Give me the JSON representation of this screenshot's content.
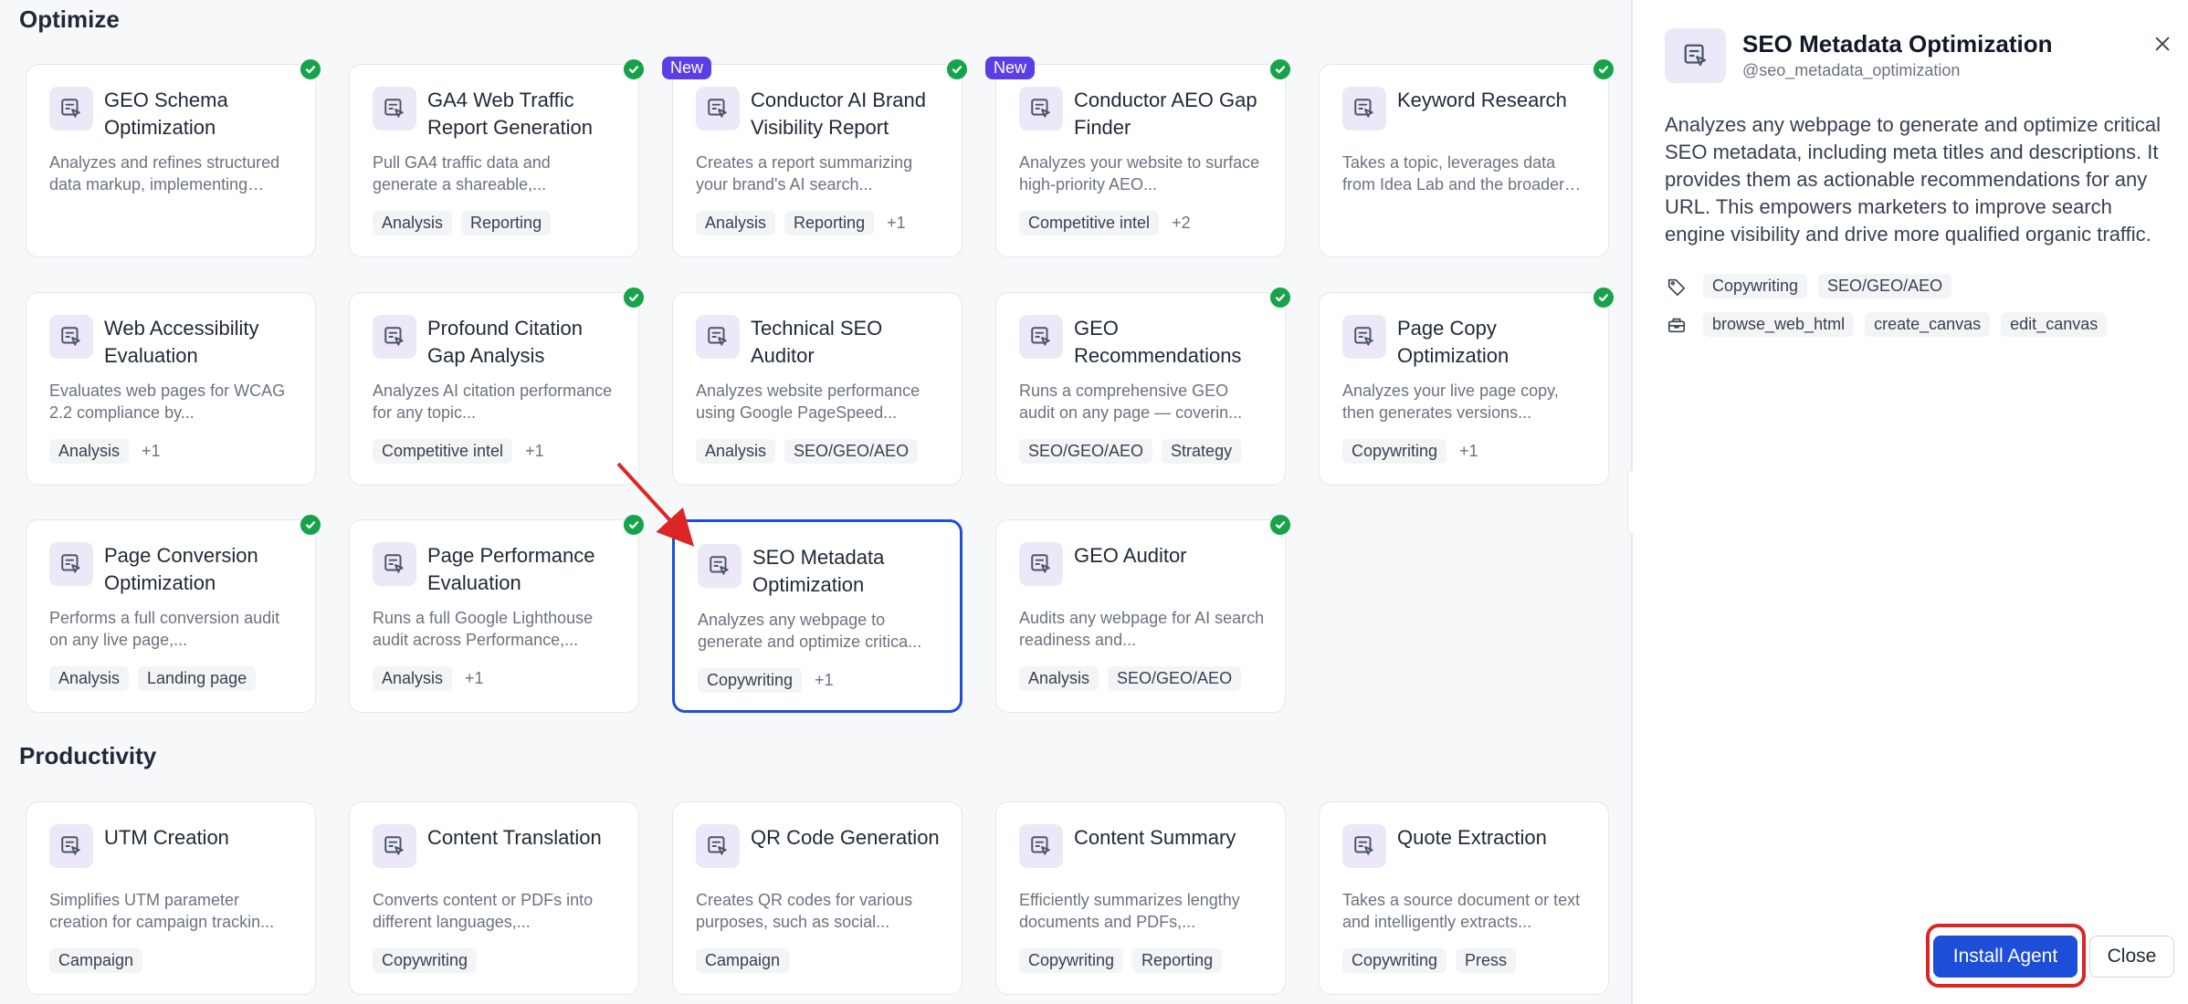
{
  "colors": {
    "accent": "#1d4ed8",
    "check": "#16a34a",
    "new_badge": "#5b3ee6",
    "highlight": "#dc2626"
  },
  "sections": {
    "optimize": "Optimize",
    "productivity": "Productivity"
  },
  "optimize_cards": [
    {
      "title": "GEO Schema Optimization",
      "desc": "Analyzes and refines structured data markup, implementing schema...",
      "tags": [],
      "more": "",
      "installed": true,
      "new": false,
      "icon": "agent-icon"
    },
    {
      "title": "GA4 Web Traffic Report Generation",
      "desc": "Pull GA4 traffic data and generate a shareable,...",
      "tags": [
        "Analysis",
        "Reporting"
      ],
      "more": "",
      "installed": true,
      "new": false,
      "icon": "agent-icon"
    },
    {
      "title": "Conductor AI Brand Visibility Report",
      "desc": "Creates a report summarizing your brand's AI search...",
      "tags": [
        "Analysis",
        "Reporting"
      ],
      "more": "+1",
      "installed": true,
      "new": true,
      "badge": "New",
      "icon": "agent-icon"
    },
    {
      "title": "Conductor AEO Gap Finder",
      "desc": "Analyzes your website to surface high-priority AEO...",
      "tags": [
        "Competitive intel"
      ],
      "more": "+2",
      "installed": true,
      "new": true,
      "badge": "New",
      "icon": "agent-icon"
    },
    {
      "title": "Keyword Research",
      "desc": "Takes a topic, leverages data from Idea Lab and the broader web, and returns a curated li...",
      "tags": [],
      "more": "",
      "installed": true,
      "new": false,
      "icon": "agent-icon"
    },
    {
      "title": "Web Accessibility Evaluation",
      "desc": "Evaluates web pages for WCAG 2.2 compliance by...",
      "tags": [
        "Analysis"
      ],
      "more": "+1",
      "installed": false,
      "new": false,
      "icon": "agent-icon"
    },
    {
      "title": "Profound Citation Gap Analysis",
      "desc": "Analyzes AI citation performance for any topic...",
      "tags": [
        "Competitive intel"
      ],
      "more": "+1",
      "installed": true,
      "new": false,
      "icon": "agent-icon"
    },
    {
      "title": "Technical SEO Auditor",
      "desc": "Analyzes website performance using Google PageSpeed...",
      "tags": [
        "Analysis",
        "SEO/GEO/AEO"
      ],
      "more": "",
      "installed": false,
      "new": false,
      "icon": "agent-icon"
    },
    {
      "title": "GEO Recommendations",
      "desc": "Runs a comprehensive GEO audit on any page — coverin...",
      "tags": [
        "SEO/GEO/AEO",
        "Strategy"
      ],
      "more": "",
      "installed": true,
      "new": false,
      "icon": "agent-icon"
    },
    {
      "title": "Page Copy Optimization",
      "desc": "Analyzes your live page copy, then generates versions...",
      "tags": [
        "Copywriting"
      ],
      "more": "+1",
      "installed": true,
      "new": false,
      "icon": "agent-icon"
    },
    {
      "title": "Page Conversion Optimization",
      "desc": "Performs a full conversion audit on any live page,...",
      "tags": [
        "Analysis",
        "Landing page"
      ],
      "more": "",
      "installed": true,
      "new": false,
      "icon": "agent-icon"
    },
    {
      "title": "Page Performance Evaluation",
      "desc": "Runs a full Google Lighthouse audit across Performance,...",
      "tags": [
        "Analysis"
      ],
      "more": "+1",
      "installed": true,
      "new": false,
      "icon": "agent-icon"
    },
    {
      "title": "SEO Metadata Optimization",
      "desc": "Analyzes any webpage to generate and optimize critica...",
      "tags": [
        "Copywriting"
      ],
      "more": "+1",
      "installed": false,
      "new": false,
      "selected": true,
      "icon": "agent-icon"
    },
    {
      "title": "GEO Auditor",
      "desc": "Audits any webpage for AI search readiness and...",
      "tags": [
        "Analysis",
        "SEO/GEO/AEO"
      ],
      "more": "",
      "installed": true,
      "new": false,
      "icon": "agent-icon"
    }
  ],
  "productivity_cards": [
    {
      "title": "UTM Creation",
      "desc": "Simplifies UTM parameter creation for campaign trackin...",
      "tags": [
        "Campaign"
      ],
      "more": "",
      "installed": false,
      "new": false,
      "icon": "agent-icon"
    },
    {
      "title": "Content Translation",
      "desc": "Converts content or PDFs into different languages,...",
      "tags": [
        "Copywriting"
      ],
      "more": "",
      "installed": false,
      "new": false,
      "icon": "agent-icon"
    },
    {
      "title": "QR Code Generation",
      "desc": "Creates QR codes for various purposes, such as social...",
      "tags": [
        "Campaign"
      ],
      "more": "",
      "installed": false,
      "new": false,
      "icon": "agent-icon"
    },
    {
      "title": "Content Summary",
      "desc": "Efficiently summarizes lengthy documents and PDFs,...",
      "tags": [
        "Copywriting",
        "Reporting"
      ],
      "more": "",
      "installed": false,
      "new": false,
      "icon": "agent-icon"
    },
    {
      "title": "Quote Extraction",
      "desc": "Takes a source document or text and intelligently extracts...",
      "tags": [
        "Copywriting",
        "Press"
      ],
      "more": "",
      "installed": false,
      "new": false,
      "icon": "agent-icon"
    }
  ],
  "panel": {
    "title": "SEO Metadata Optimization",
    "handle": "@seo_metadata_optimization",
    "description": "Analyzes any webpage to generate and optimize critical SEO metadata, including meta titles and descriptions. It provides them as actionable recommendations for any URL. This empowers marketers to improve search engine visibility and drive more qualified organic traffic.",
    "tags": [
      "Copywriting",
      "SEO/GEO/AEO"
    ],
    "tools": [
      "browse_web_html",
      "create_canvas",
      "edit_canvas"
    ],
    "install_label": "Install Agent",
    "close_label": "Close"
  }
}
